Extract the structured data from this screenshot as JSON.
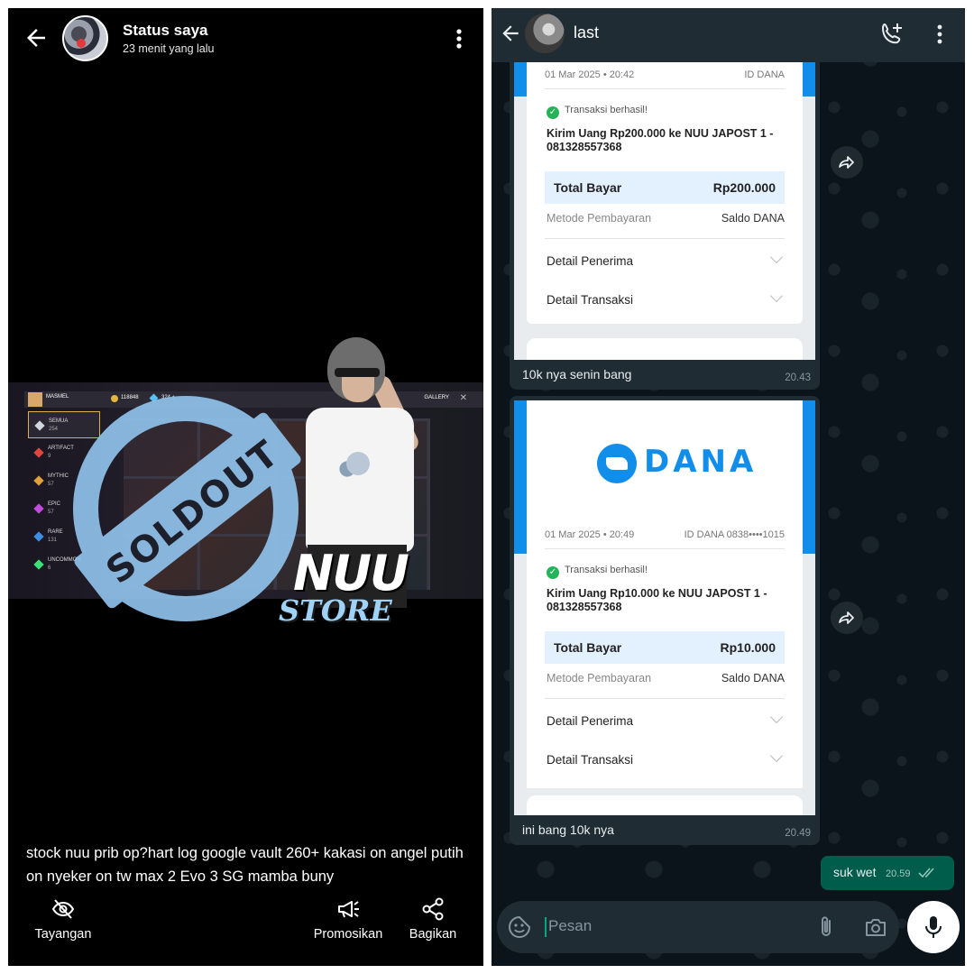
{
  "status_view": {
    "title": "Status saya",
    "time_ago": "23 menit yang lalu",
    "image": {
      "stamp_text": "SOLDOUT",
      "logo_line1": "NUU",
      "logo_line2": "STORE",
      "game_player": "MASMEL",
      "game_coins": "118848",
      "game_diamonds": "324 +",
      "game_gallery": "GALLERY",
      "categories": [
        {
          "label": "SEMUA",
          "count": "254",
          "color": "#cfd6e0"
        },
        {
          "label": "ARTIFACT",
          "count": "9",
          "color": "#e0463c"
        },
        {
          "label": "MYTHIC",
          "count": "57",
          "color": "#e0a03c"
        },
        {
          "label": "EPIC",
          "count": "57",
          "color": "#c34be0"
        },
        {
          "label": "RARE",
          "count": "131",
          "color": "#3c8ee0"
        },
        {
          "label": "UNCOMMON",
          "count": "6",
          "color": "#3ce07a"
        }
      ]
    },
    "caption": "stock nuu prib op?hart log google vault 260+ kakasi on angel putih on nyeker on tw max 2 Evo 3 SG mamba buny",
    "actions": {
      "views": "Tayangan",
      "promote": "Promosikan",
      "share": "Bagikan"
    }
  },
  "chat": {
    "contact_name": "last",
    "messages": [
      {
        "type": "image",
        "receipt": {
          "date": "01 Mar 2025 • 20:42",
          "id": "ID DANA",
          "status": "Transaksi berhasil!",
          "description": "Kirim Uang Rp200.000 ke NUU JAPOST 1 - 081328557368",
          "total_label": "Total Bayar",
          "total_value": "Rp200.000",
          "method_label": "Metode Pembayaran",
          "method_value": "Saldo DANA",
          "recipient_label": "Detail Penerima",
          "transaction_label": "Detail Transaksi"
        },
        "caption": "10k nya senin bang",
        "time": "20.43"
      },
      {
        "type": "image",
        "receipt": {
          "brand": "DANA",
          "date": "01 Mar 2025 • 20:49",
          "id": "ID DANA 0838••••1015",
          "status": "Transaksi berhasil!",
          "description": "Kirim Uang Rp10.000 ke NUU JAPOST 1 - 081328557368",
          "total_label": "Total Bayar",
          "total_value": "Rp10.000",
          "method_label": "Metode Pembayaran",
          "method_value": "Saldo DANA",
          "recipient_label": "Detail Penerima",
          "transaction_label": "Detail Transaksi"
        },
        "caption": "ini bang 10k nya",
        "time": "20.49"
      },
      {
        "type": "text",
        "direction": "outgoing",
        "text": "suk wet",
        "time": "20.59",
        "status": "read"
      }
    ],
    "composer": {
      "placeholder": "Pesan"
    }
  },
  "colors": {
    "dana_blue": "#118ee9",
    "outgoing_bubble": "#005c4b",
    "incoming_bubble": "#1f2c34",
    "chat_bg": "#0b141a",
    "success_green": "#25b35a"
  }
}
